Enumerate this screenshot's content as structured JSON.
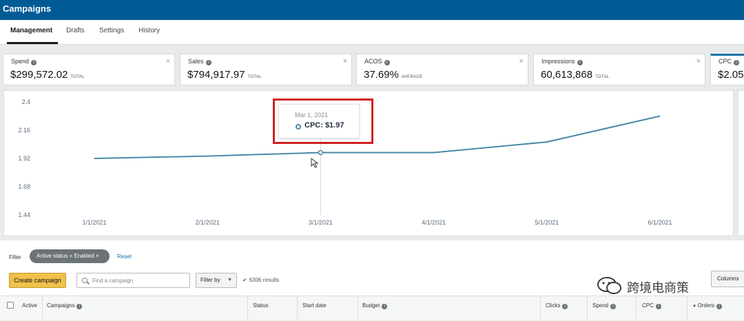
{
  "app": {
    "title": "Campaigns"
  },
  "tabs": [
    {
      "label": "Management",
      "active": true
    },
    {
      "label": "Drafts"
    },
    {
      "label": "Settings"
    },
    {
      "label": "History"
    }
  ],
  "metrics": [
    {
      "label": "Spend",
      "value": "$299,572.02",
      "sub": "TOTAL"
    },
    {
      "label": "Sales",
      "value": "$794,917.97",
      "sub": "TOTAL"
    },
    {
      "label": "ACOS",
      "value": "37.69%",
      "sub": "AVERAGE"
    },
    {
      "label": "Impressions",
      "value": "60,613,868",
      "sub": "TOTAL"
    },
    {
      "label": "CPC",
      "value": "$2.05"
    }
  ],
  "chart_data": {
    "type": "line",
    "x": [
      "1/1/2021",
      "2/1/2021",
      "3/1/2021",
      "4/1/2021",
      "5/1/2021",
      "6/1/2021"
    ],
    "series": [
      {
        "name": "CPC",
        "values": [
          1.92,
          1.94,
          1.97,
          1.97,
          2.06,
          2.28
        ]
      }
    ],
    "y_ticks": [
      "2.4",
      "2.16",
      "1.92",
      "1.68",
      "1.44"
    ],
    "ylim": [
      1.44,
      2.4
    ],
    "color": "#4a88a8"
  },
  "tooltip": {
    "date": "Mar 1, 2021",
    "value": "CPC: $1.97"
  },
  "filter": {
    "label": "Filter",
    "chip": "Active status = Enabled",
    "reset": "Reset"
  },
  "toolbar": {
    "create": "Create campaign",
    "search_placeholder": "Find a campaign",
    "filter_by": "Filter by",
    "results": "6306 results",
    "columns": "Columns"
  },
  "watermark": "跨境电商策",
  "table": {
    "headers": [
      "Active",
      "Campaigns",
      "Status",
      "Start date",
      "Budget",
      "Clicks",
      "Spend",
      "CPC",
      "Orders"
    ]
  }
}
